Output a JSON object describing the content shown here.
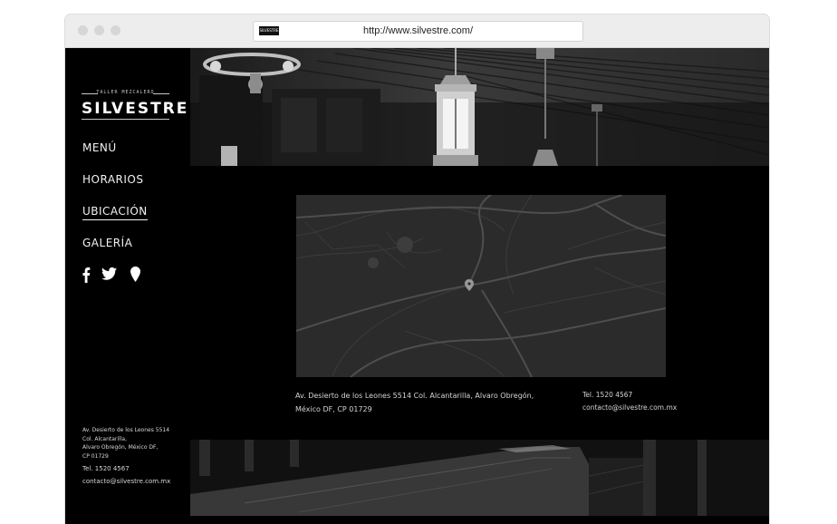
{
  "browser": {
    "url": "http://www.silvestre.com/",
    "favicon_text": "SILVESTRE"
  },
  "logo": {
    "tagline": "TALLER MEZCALERO",
    "name": "SILVESTRE"
  },
  "nav": {
    "items": [
      {
        "label": "MENÚ",
        "active": false
      },
      {
        "label": "HORARIOS",
        "active": false
      },
      {
        "label": "UBICACIÓN",
        "active": true
      },
      {
        "label": "GALERÍA",
        "active": false
      }
    ]
  },
  "social": {
    "icons": [
      "facebook-icon",
      "twitter-icon",
      "map-pin-icon"
    ]
  },
  "sidebar_info": {
    "address": "Av. Desierto de los Leones 5514\nCol. Alcantarilla,\nAlvaro Obregón, México DF,\nCP 01729",
    "phone": "Tel. 1520 4567",
    "email": "contacto@silvestre.com.mx"
  },
  "location": {
    "address_line1": "Av. Desierto de los Leones 5514  Col. Alcantarilla, Alvaro Obregón,",
    "address_line2": "México DF, CP 01729",
    "phone": "Tel. 1520 4567",
    "email": "contacto@silvestre.com.mx"
  },
  "colors": {
    "page_bg": "#000000",
    "text": "#f2f2f2",
    "map_bg": "#2a2a2a"
  }
}
